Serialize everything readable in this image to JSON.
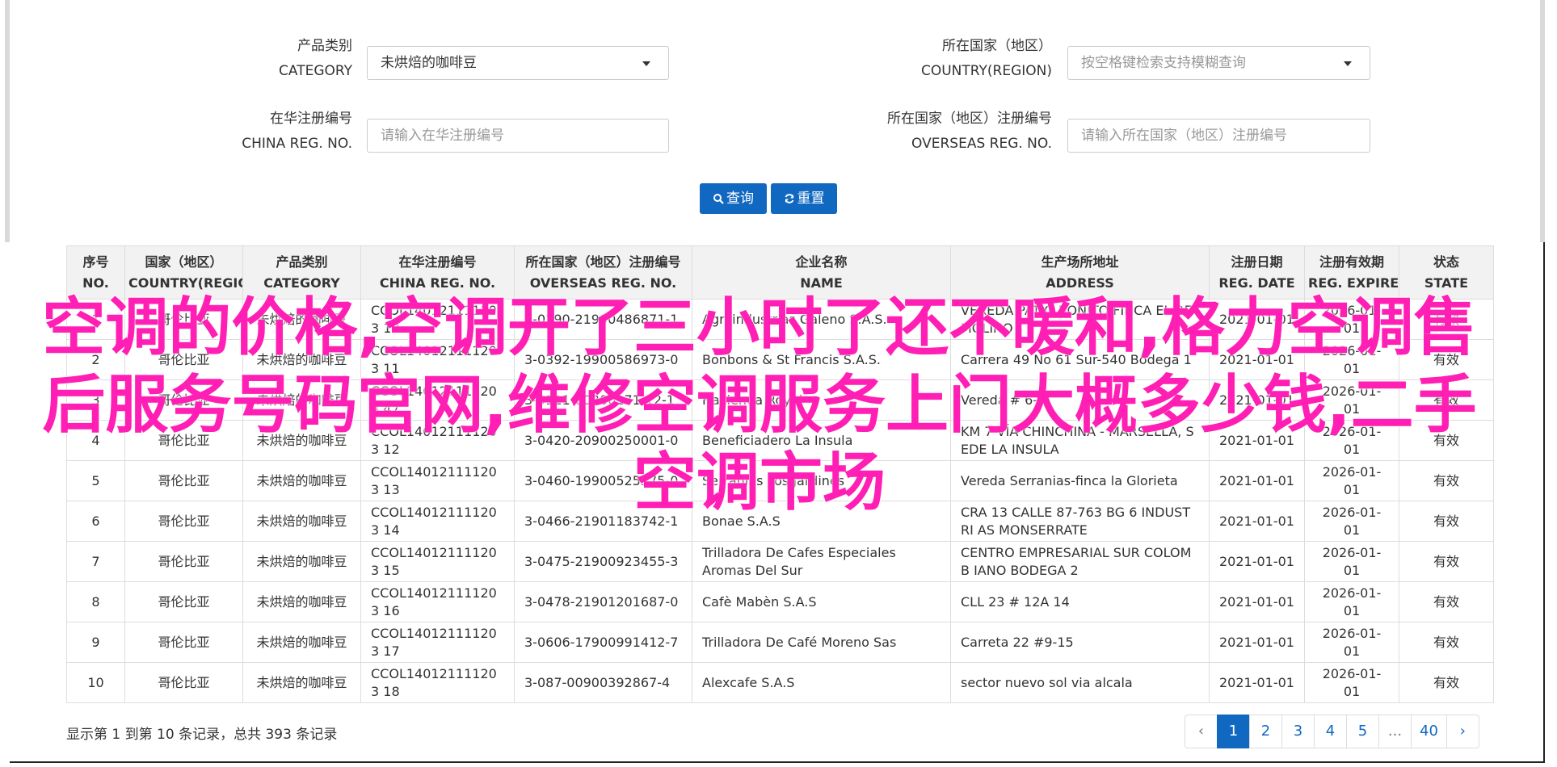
{
  "form": {
    "category": {
      "label_cn": "产品类别",
      "label_en": "CATEGORY",
      "value": "未烘焙的咖啡豆"
    },
    "country": {
      "label_cn": "所在国家（地区）",
      "label_en": "COUNTRY(REGION)",
      "placeholder": "按空格键检索支持模糊查询"
    },
    "china_reg": {
      "label_cn": "在华注册编号",
      "label_en": "CHINA REG. NO.",
      "placeholder": "请输入在华注册编号"
    },
    "overseas_reg": {
      "label_cn": "所在国家（地区）注册编号",
      "label_en": "OVERSEAS REG. NO.",
      "placeholder": "请输入所在国家（地区）注册编号"
    },
    "search_label": "查询",
    "reset_label": "重置"
  },
  "table": {
    "headers": [
      {
        "cn": "序号",
        "en": "NO."
      },
      {
        "cn": "国家（地区）",
        "en": "COUNTRY(REGIO..."
      },
      {
        "cn": "产品类别",
        "en": "CATEGORY"
      },
      {
        "cn": "在华注册编号",
        "en": "CHINA REG. NO."
      },
      {
        "cn": "所在国家（地区）注册编号",
        "en": "OVERSEAS REG. NO."
      },
      {
        "cn": "企业名称",
        "en": "NAME"
      },
      {
        "cn": "生产场所地址",
        "en": "ADDRESS"
      },
      {
        "cn": "注册日期",
        "en": "REG. DATE"
      },
      {
        "cn": "注册有效期",
        "en": "REG. EXPIRE ..."
      },
      {
        "cn": "状态",
        "en": "STATE"
      }
    ],
    "rows": [
      {
        "no": "1",
        "country": "哥伦比亚",
        "category": "未烘焙的咖啡豆",
        "china_reg": "CCOL140121111203 10",
        "overseas_reg": "3-0390-21900486871-1",
        "name": "Agroindustrias Galeno S.A.S.",
        "address": "VEREDA PATIO BONITO FINCA EL REMOLINO",
        "reg_date": "2021-01-01",
        "expire": "2026-01-01",
        "state": "有效"
      },
      {
        "no": "2",
        "country": "哥伦比亚",
        "category": "未烘焙的咖啡豆",
        "china_reg": "CCOL140121111203 11",
        "overseas_reg": "3-0392-19900586973-0",
        "name": "Bonbons & St Francis S.A.S.",
        "address": "Carrera 49 No 61 Sur-540 Bodega 1",
        "reg_date": "2021-01-01",
        "expire": "2026-01-01",
        "state": "有效"
      },
      {
        "no": "3",
        "country": "哥伦比亚",
        "category": "未烘焙的咖啡豆",
        "china_reg": "CCOL140121111203 47",
        "overseas_reg": "3-0111-00300171-12-1",
        "name": "Hacienda Royal",
        "address": "Vereda # 6-5",
        "reg_date": "2021-01-01",
        "expire": "2026-01-01",
        "state": "有效"
      },
      {
        "no": "4",
        "country": "哥伦比亚",
        "category": "未烘焙的咖啡豆",
        "china_reg": "CCOL140121111203 12",
        "overseas_reg": "3-0420-20900250001-0",
        "name": "Beneficiadero La Insula",
        "address": "KM 7 VÍA CHINCHINA - MARSELLA, S EDE LA INSULA",
        "reg_date": "2021-01-01",
        "expire": "2026-01-01",
        "state": "有效"
      },
      {
        "no": "5",
        "country": "哥伦比亚",
        "category": "未烘焙的咖啡豆",
        "china_reg": "CCOL140121111203 13",
        "overseas_reg": "3-0460-19900525575-0",
        "name": "Serranias Los Jardines",
        "address": "Vereda Serranias-finca la Glorieta",
        "reg_date": "2021-01-01",
        "expire": "2026-01-01",
        "state": "有效"
      },
      {
        "no": "6",
        "country": "哥伦比亚",
        "category": "未烘焙的咖啡豆",
        "china_reg": "CCOL140121111203 14",
        "overseas_reg": "3-0466-21901183742-1",
        "name": "Bonae S.A.S",
        "address": "CRA 13 CALLE 87-763 BG 6 INDUSTRI AS MONSERRATE",
        "reg_date": "2021-01-01",
        "expire": "2026-01-01",
        "state": "有效"
      },
      {
        "no": "7",
        "country": "哥伦比亚",
        "category": "未烘焙的咖啡豆",
        "china_reg": "CCOL140121111203 15",
        "overseas_reg": "3-0475-21900923455-3",
        "name": "Trilladora De Cafes Especiales Aromas Del Sur",
        "address": "CENTRO EMPRESARIAL SUR COLOMB IANO BODEGA 2",
        "reg_date": "2021-01-01",
        "expire": "2026-01-01",
        "state": "有效"
      },
      {
        "no": "8",
        "country": "哥伦比亚",
        "category": "未烘焙的咖啡豆",
        "china_reg": "CCOL140121111203 16",
        "overseas_reg": "3-0478-21901201687-0",
        "name": "Cafè Mabèn S.A.S",
        "address": "CLL 23 # 12A 14",
        "reg_date": "2021-01-01",
        "expire": "2026-01-01",
        "state": "有效"
      },
      {
        "no": "9",
        "country": "哥伦比亚",
        "category": "未烘焙的咖啡豆",
        "china_reg": "CCOL140121111203 17",
        "overseas_reg": "3-0606-17900991412-7",
        "name": "Trilladora De Café Moreno Sas",
        "address": "Carreta 22 #9-15",
        "reg_date": "2021-01-01",
        "expire": "2026-01-01",
        "state": "有效"
      },
      {
        "no": "10",
        "country": "哥伦比亚",
        "category": "未烘焙的咖啡豆",
        "china_reg": "CCOL140121111203 18",
        "overseas_reg": "3-087-00900392867-4",
        "name": "Alexcafe S.A.S",
        "address": "sector nuevo sol via alcala",
        "reg_date": "2021-01-01",
        "expire": "2026-01-01",
        "state": "有效"
      }
    ]
  },
  "summary": "显示第 1 到第 10 条记录，总共 393 条记录",
  "pagination": {
    "prev": "‹",
    "pages": [
      "1",
      "2",
      "3",
      "4",
      "5",
      "...",
      "40"
    ],
    "next": "›",
    "active": "1"
  },
  "watermark": "空调的价格,空调开了三小时了还不暖和,格力空调售后服务号码官网,维修空调服务上门大概多少钱,二手空调市场",
  "colors": {
    "accent": "#1168c0",
    "watermark": "#ff1fb4"
  }
}
